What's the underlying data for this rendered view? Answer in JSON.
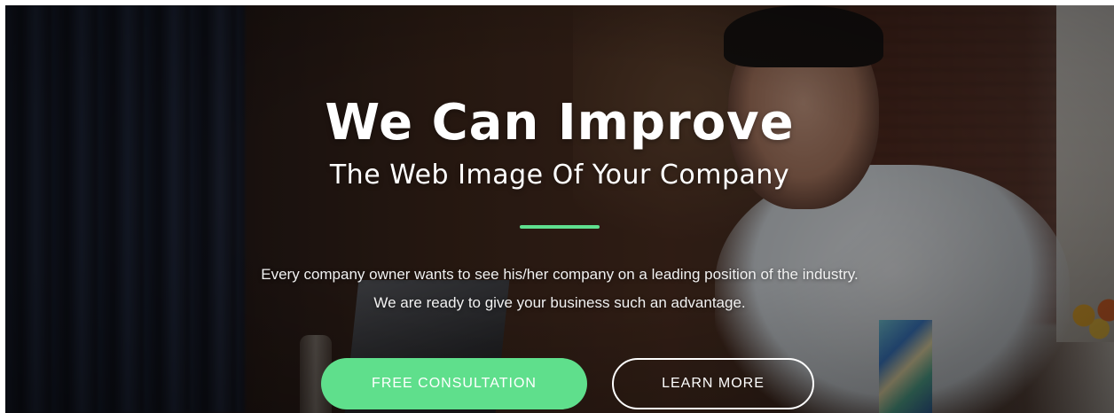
{
  "hero": {
    "headline": "We Can Improve",
    "subheadline": "The Web Image Of Your Company",
    "description": "Every company owner wants to see his/her company on a leading position of the industry. We are ready to give your business such an advantage.",
    "primary_button_label": "FREE CONSULTATION",
    "secondary_button_label": "LEARN MORE"
  },
  "colors": {
    "accent": "#5fdf8c",
    "text": "#ffffff"
  }
}
